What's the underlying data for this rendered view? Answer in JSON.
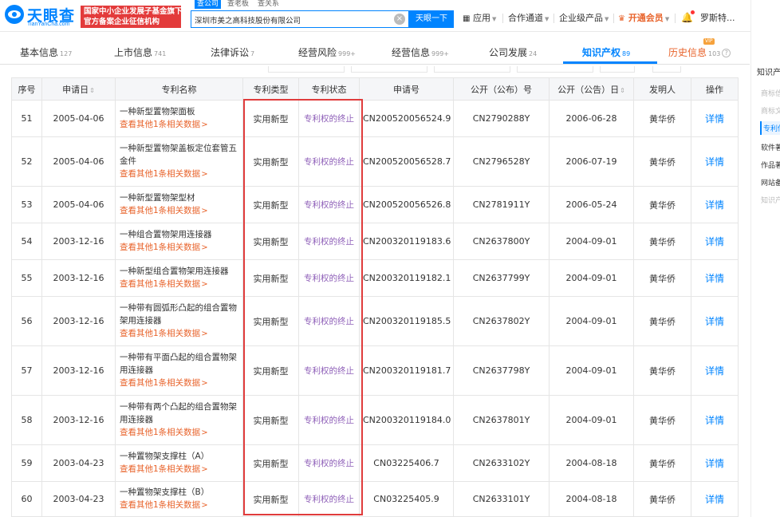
{
  "header": {
    "logo_text": "天眼查",
    "logo_sub": "TianYanCha.com",
    "banner_line1": "国家中小企业发展子基金旗下",
    "banner_line2": "官方备案企业征信机构",
    "search_tabs": [
      "查公司",
      "查老板",
      "查关系"
    ],
    "search_value": "深圳市美之高科技股份有限公司",
    "clear_label": "×",
    "search_button": "天眼一下",
    "nav_app": "应用",
    "nav_cooperate": "合作通道",
    "nav_enterprise": "企业级产品",
    "nav_vip": "开通会员",
    "nav_user": "罗斯特..."
  },
  "tabs": [
    {
      "label": "基本信息",
      "count": "127"
    },
    {
      "label": "上市信息",
      "count": "741"
    },
    {
      "label": "法律诉讼",
      "count": "7"
    },
    {
      "label": "经营风险",
      "count": "999+"
    },
    {
      "label": "经营信息",
      "count": "999+"
    },
    {
      "label": "公司发展",
      "count": "24"
    },
    {
      "label": "知识产权",
      "count": "89"
    },
    {
      "label": "历史信息",
      "count": "103"
    }
  ],
  "vip_badge": "VIP",
  "sidebar": {
    "title": "知识产",
    "items": [
      "商标信",
      "商标文",
      "专利信",
      "软件著",
      "作品著",
      "网站备",
      "知识产"
    ]
  },
  "table": {
    "columns": [
      "序号",
      "申请日",
      "专利名称",
      "专利类型",
      "专利状态",
      "申请号",
      "公开（公布）号",
      "公开（公告）日",
      "发明人",
      "操作"
    ],
    "more_text": "查看其他1条相关数据",
    "detail_text": "详情",
    "rows": [
      {
        "no": "51",
        "apply_date": "2005-04-06",
        "name": "一种新型置物架面板",
        "type": "实用新型",
        "status": "专利权的终止",
        "app_no": "CN200520056524.9",
        "pub_no": "CN2790288Y",
        "pub_date": "2006-06-28",
        "inventor": "黄华侨"
      },
      {
        "no": "52",
        "apply_date": "2005-04-06",
        "name": "一种新型置物架盖板定位套管五金件",
        "type": "实用新型",
        "status": "专利权的终止",
        "app_no": "CN200520056528.7",
        "pub_no": "CN2796528Y",
        "pub_date": "2006-07-19",
        "inventor": "黄华侨"
      },
      {
        "no": "53",
        "apply_date": "2005-04-06",
        "name": "一种新型置物架型材",
        "type": "实用新型",
        "status": "专利权的终止",
        "app_no": "CN200520056526.8",
        "pub_no": "CN2781911Y",
        "pub_date": "2006-05-24",
        "inventor": "黄华侨"
      },
      {
        "no": "54",
        "apply_date": "2003-12-16",
        "name": "一种组合置物架用连接器",
        "type": "实用新型",
        "status": "专利权的终止",
        "app_no": "CN200320119183.6",
        "pub_no": "CN2637800Y",
        "pub_date": "2004-09-01",
        "inventor": "黄华侨"
      },
      {
        "no": "55",
        "apply_date": "2003-12-16",
        "name": "一种新型组合置物架用连接器",
        "type": "实用新型",
        "status": "专利权的终止",
        "app_no": "CN200320119182.1",
        "pub_no": "CN2637799Y",
        "pub_date": "2004-09-01",
        "inventor": "黄华侨"
      },
      {
        "no": "56",
        "apply_date": "2003-12-16",
        "name": "一种带有圆弧形凸起的组合置物架用连接器",
        "type": "实用新型",
        "status": "专利权的终止",
        "app_no": "CN200320119185.5",
        "pub_no": "CN2637802Y",
        "pub_date": "2004-09-01",
        "inventor": "黄华侨"
      },
      {
        "no": "57",
        "apply_date": "2003-12-16",
        "name": "一种带有平面凸起的组合置物架用连接器",
        "type": "实用新型",
        "status": "专利权的终止",
        "app_no": "CN200320119181.7",
        "pub_no": "CN2637798Y",
        "pub_date": "2004-09-01",
        "inventor": "黄华侨"
      },
      {
        "no": "58",
        "apply_date": "2003-12-16",
        "name": "一种带有两个凸起的组合置物架用连接器",
        "type": "实用新型",
        "status": "专利权的终止",
        "app_no": "CN200320119184.0",
        "pub_no": "CN2637801Y",
        "pub_date": "2004-09-01",
        "inventor": "黄华侨"
      },
      {
        "no": "59",
        "apply_date": "2003-04-23",
        "name": "一种置物架支撑柱（A）",
        "type": "实用新型",
        "status": "专利权的终止",
        "app_no": "CN03225406.7",
        "pub_no": "CN2633102Y",
        "pub_date": "2004-08-18",
        "inventor": "黄华侨"
      },
      {
        "no": "60",
        "apply_date": "2003-04-23",
        "name": "一种置物架支撑柱（B）",
        "type": "实用新型",
        "status": "专利权的终止",
        "app_no": "CN03225405.9",
        "pub_no": "CN2633101Y",
        "pub_date": "2004-08-18",
        "inventor": "黄华侨"
      }
    ]
  },
  "colors": {
    "brand": "#0084ff",
    "more_link": "#e8632b",
    "status_text": "#8e5fb8",
    "highlight": "#e03c3c"
  }
}
